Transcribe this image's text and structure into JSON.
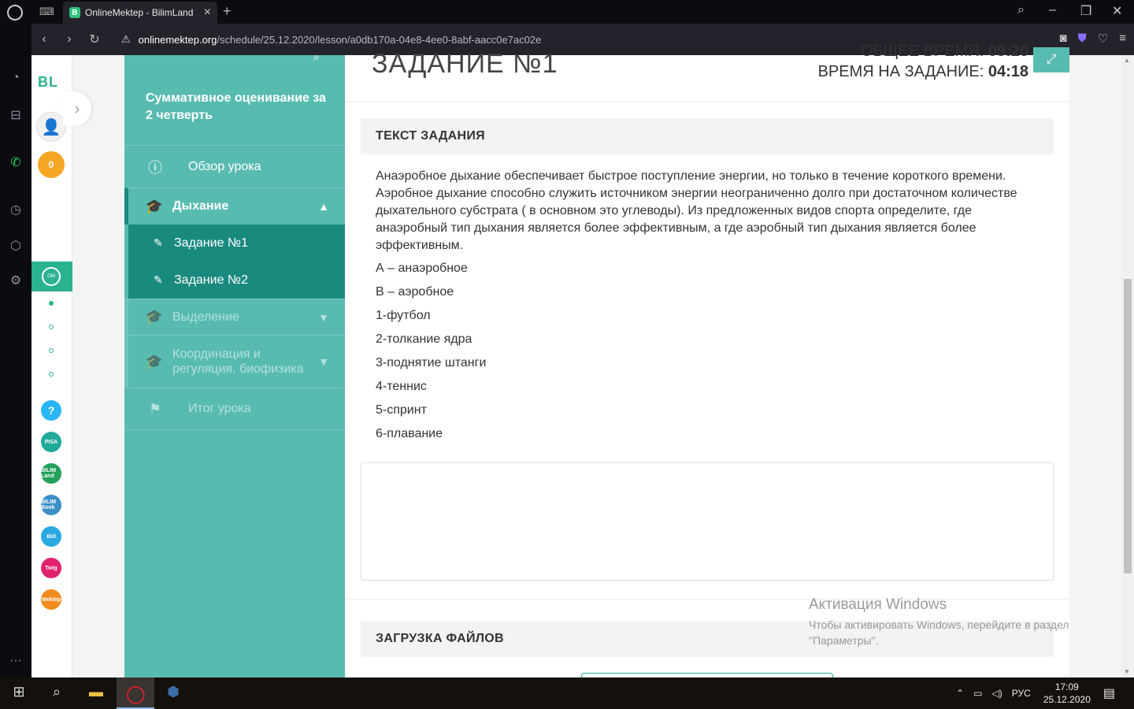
{
  "browser": {
    "tab_title": "OnlineMektep - BilimLand",
    "url_host": "onlinemektep.org",
    "url_path": "/schedule/25.12.2020/lesson/a0db170a-04e8-4ee0-8abf-aacc0e7ac02e"
  },
  "strip": {
    "logo": "BL",
    "coins": "0",
    "help": "?",
    "apps": [
      "PISA",
      "BILIM Land",
      "BILIM Book",
      "Bid",
      "Twig",
      "Mektep"
    ]
  },
  "lesson": {
    "title": "Суммативное оценивание за 2 четверть",
    "overview": "Обзор урока",
    "section_active": "Дыхание",
    "tasks": [
      "Задание №1",
      "Задание №2"
    ],
    "section_2": "Выделение",
    "section_3": "Координация и регуляция, биофизика",
    "summary": "Итог урока"
  },
  "main": {
    "task_title": "ЗАДАНИЕ №1",
    "total_time_label": "ОБЩЕЕ ВРЕМЯ:",
    "total_time_value": "09:20",
    "task_time_label": "ВРЕМЯ НА ЗАДАНИЕ:",
    "task_time_value": "04:18",
    "text_header": "ТЕКСТ ЗАДАНИЯ",
    "task_text": "Анаэробное дыхание обеспечивает быстрое поступление энергии, но только в течение короткого времени. Аэробное дыхание способно служить источником энергии неограниченно долго при достаточном количестве дыхательного субстрата ( в основном это углеводы). Из предложенных видов спорта определите, где анаэробный тип дыхания является более эффективным, а где аэробный тип дыхания является более эффективным.",
    "options": [
      "А – анаэробное",
      "В – аэробное",
      "1-футбол",
      "2-толкание ядра",
      "3-поднятие штанги",
      "4-теннис",
      "5-спринт",
      "6-плавание"
    ],
    "answer_value": "",
    "upload_header": "ЗАГРУЗКА ФАЙЛОВ"
  },
  "watermark": {
    "title": "Активация Windows",
    "text": "Чтобы активировать Windows, перейдите в раздел \"Параметры\"."
  },
  "taskbar": {
    "lang": "РУС",
    "time": "17:09",
    "date": "25.12.2020"
  },
  "colors": {
    "accent": "#58bbb0",
    "accent_dark": "#1a8a7f",
    "brand": "#2bb28f"
  }
}
